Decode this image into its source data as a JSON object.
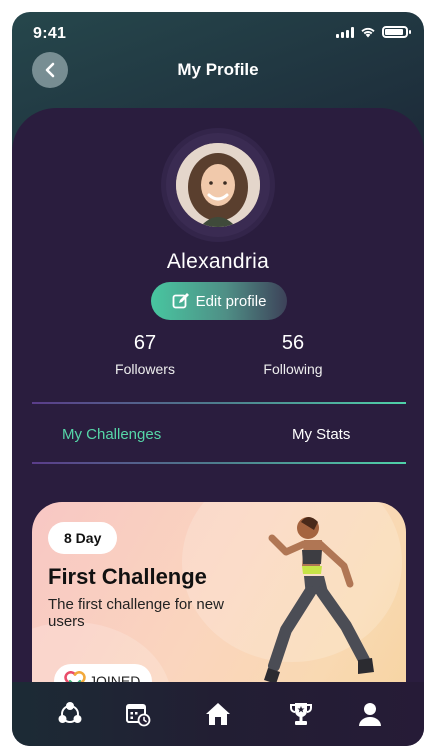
{
  "status_bar": {
    "time": "9:41"
  },
  "header": {
    "title": "My Profile",
    "back_icon": "chevron-left-icon"
  },
  "profile": {
    "name": "Alexandria",
    "edit_label": "Edit profile",
    "followers_count": "67",
    "followers_label": "Followers",
    "following_count": "56",
    "following_label": "Following"
  },
  "tabs": [
    {
      "label": "My Challenges",
      "active": true
    },
    {
      "label": "My Stats",
      "active": false
    }
  ],
  "challenge": {
    "badge": "8 Day",
    "title": "First Challenge",
    "description": "The first challenge for new users",
    "joined_label": "JOINED"
  },
  "nav": {
    "items": [
      "community-icon",
      "calendar-icon",
      "home-icon",
      "trophy-icon",
      "profile-icon"
    ]
  },
  "colors": {
    "accent": "#56d6a8",
    "panel": "#2a1d3e"
  }
}
